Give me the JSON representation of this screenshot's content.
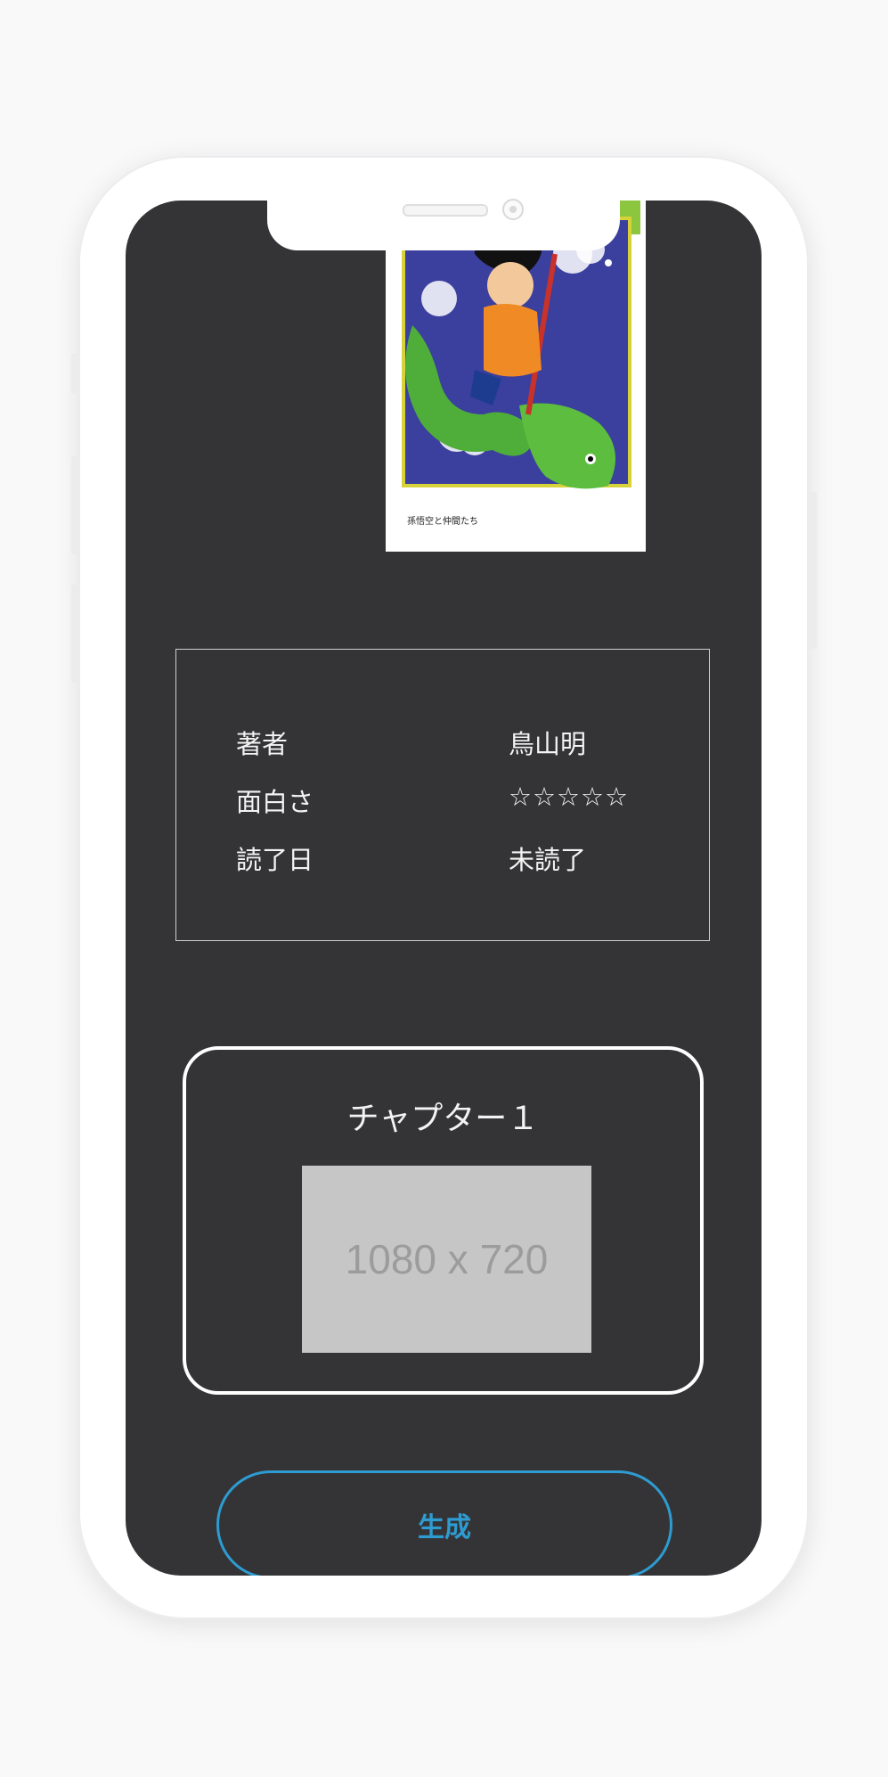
{
  "book": {
    "cover_caption": "孫悟空と仲間たち",
    "info": [
      {
        "label": "著者",
        "value": "鳥山明"
      },
      {
        "label": "面白さ",
        "value": "☆☆☆☆☆"
      },
      {
        "label": "読了日",
        "value": "未読了"
      }
    ]
  },
  "chapter": {
    "title": "チャプター１",
    "image_placeholder": "1080 x 720"
  },
  "actions": {
    "generate_label": "生成"
  },
  "colors": {
    "screen_bg": "#343437",
    "accent": "#2e9bd1",
    "text": "#f3f3f3"
  },
  "icons": [
    "speaker-grille",
    "front-camera"
  ]
}
